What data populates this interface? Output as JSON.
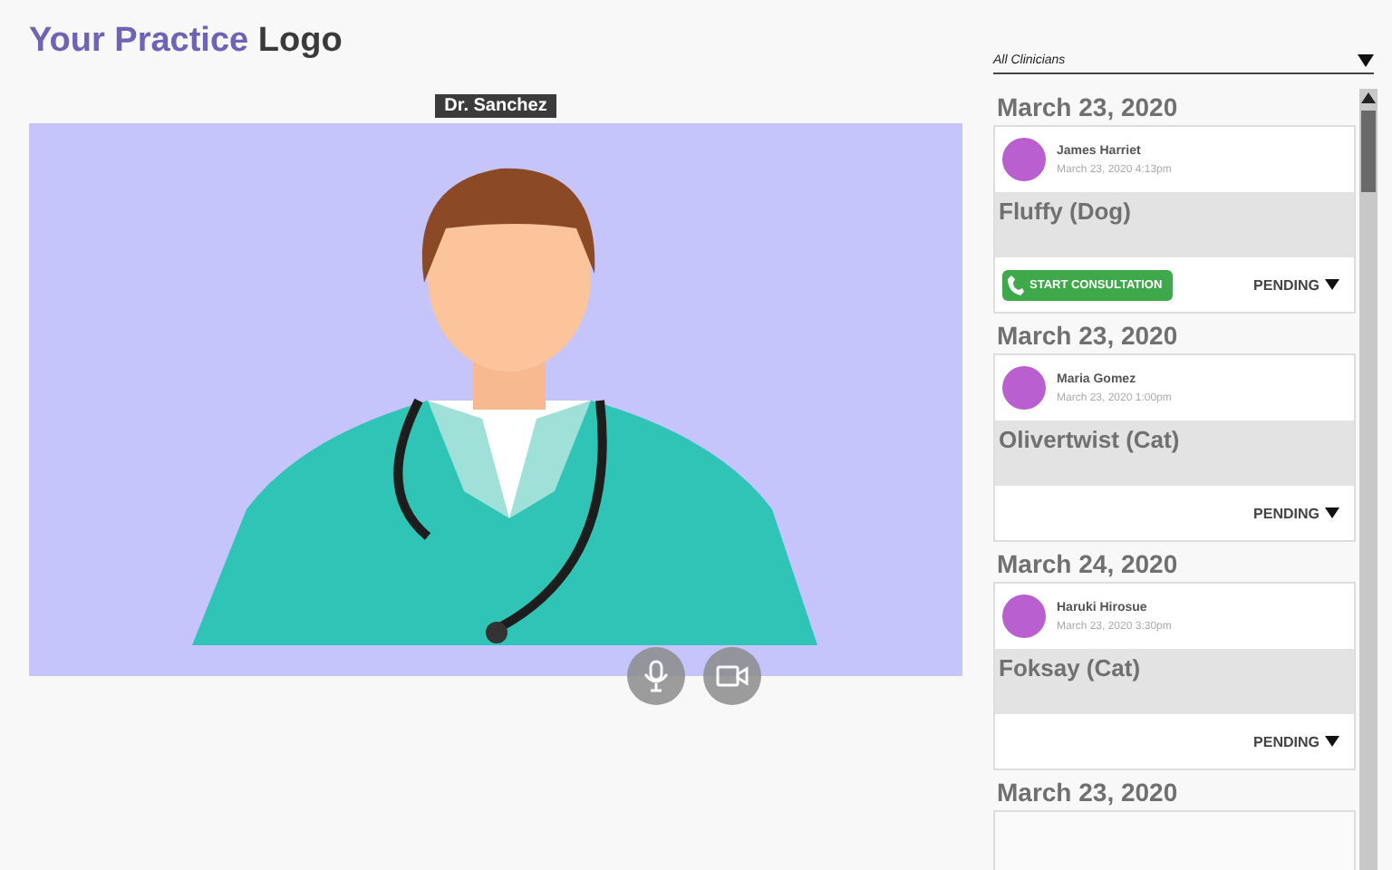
{
  "header": {
    "logo_brand": "Your Practice",
    "logo_word": "Logo"
  },
  "video": {
    "caller_name": "Dr. Sanchez",
    "controls": [
      {
        "kind": "mic"
      },
      {
        "kind": "camera"
      }
    ]
  },
  "filter": {
    "value": "All Clinicians"
  },
  "appointments": [
    {
      "date": "March 23, 2020",
      "client": "James Harriet",
      "time": "March 23, 2020 4:13pm",
      "pet": "Fluffy (Dog)",
      "action": "START CONSULTATION",
      "status": "PENDING"
    },
    {
      "date": "March 23, 2020",
      "client": "Maria Gomez",
      "time": "March 23, 2020 1:00pm",
      "pet": "Olivertwist (Cat)",
      "status": "PENDING"
    },
    {
      "date": "March 24, 2020",
      "client": "Haruki Hirosue",
      "time": "March 23, 2020 3:30pm",
      "pet": "Foksay (Cat)",
      "status": "PENDING"
    },
    {
      "date": "March 23, 2020"
    }
  ]
}
